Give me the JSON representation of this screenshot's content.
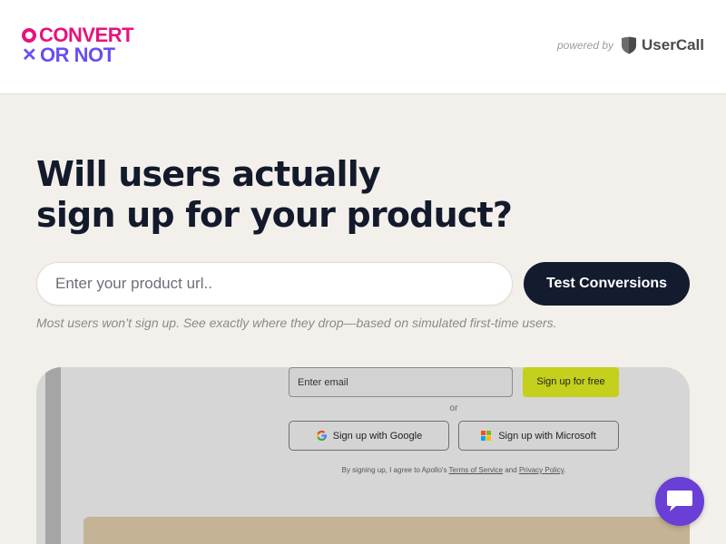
{
  "header": {
    "logo": {
      "line1": "CONVERT",
      "line2": "OR NOT",
      "prefix1_icon": "circle-o-icon",
      "prefix2_icon": "x-mark-icon"
    },
    "powered_by": {
      "text": "powered by",
      "brand": "UserCall",
      "brand_icon": "usercall-shield-icon"
    }
  },
  "hero": {
    "headline_line1": "Will users actually",
    "headline_line2": "sign up for your product?",
    "url_input": {
      "placeholder": "Enter your product url..",
      "value": ""
    },
    "test_button_label": "Test Conversions",
    "subtext": "Most users won’t sign up. See exactly where they drop—based on simulated first-time users."
  },
  "preview": {
    "email_placeholder": "Enter email",
    "signup_label": "Sign up for free",
    "or_label": "or",
    "google_label": "Sign up with Google",
    "microsoft_label": "Sign up with Microsoft",
    "terms_prefix": "By signing up, I agree to Apollo's",
    "terms_link": "Terms of Service",
    "terms_and": "and",
    "privacy_link": "Privacy Policy",
    "terms_suffix": "."
  },
  "chat": {
    "icon": "chat-bubble-icon"
  },
  "colors": {
    "logo_pink": "#e8127c",
    "logo_purple": "#6b4ef0",
    "primary_dark": "#131b2e",
    "signup_accent": "#c4d01c",
    "chat_purple": "#6a3fd6",
    "page_bg": "#f3efea"
  }
}
